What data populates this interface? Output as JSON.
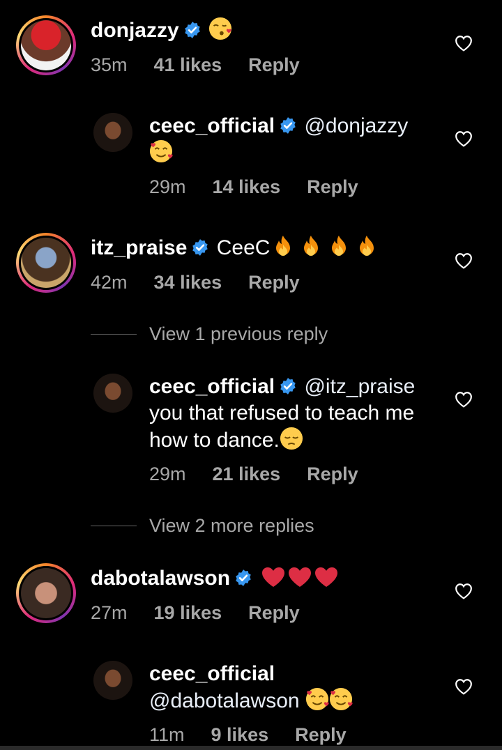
{
  "comments": [
    {
      "username": "donjazzy",
      "text": "",
      "emoji": "kissing-face-emoji",
      "time": "35m",
      "likes": "41 likes",
      "reply": "Reply"
    },
    {
      "username": "ceec_official",
      "mention": "@donjazzy",
      "emoji": "smiling-face-with-hearts-emoji",
      "time": "29m",
      "likes": "14 likes",
      "reply": "Reply"
    },
    {
      "username": "itz_praise",
      "text": "CeeC",
      "emoji": "fire-emoji x4",
      "time": "42m",
      "likes": "34 likes",
      "reply": "Reply"
    },
    {
      "username": "ceec_official",
      "mention": "@itz_praise",
      "text_line2": "you that refused to teach me",
      "text_line3": "how to dance.",
      "emoji": "pensive-face-emoji",
      "time": "29m",
      "likes": "21 likes",
      "reply": "Reply"
    },
    {
      "username": "dabotalawson",
      "emoji": "red-heart-emoji x3",
      "time": "27m",
      "likes": "19 likes",
      "reply": "Reply"
    },
    {
      "username": "ceec_official",
      "mention": "@dabotalawson",
      "emoji": "smiling-face-with-hearts-emoji x2",
      "time": "11m",
      "likes": "9 likes",
      "reply": "Reply"
    }
  ],
  "view_previous": "View 1 previous reply",
  "view_more": "View 2 more replies",
  "colors": {
    "background": "#000000",
    "text": "#ffffff",
    "meta": "#a8a8a8",
    "verified": "#3897f0"
  }
}
